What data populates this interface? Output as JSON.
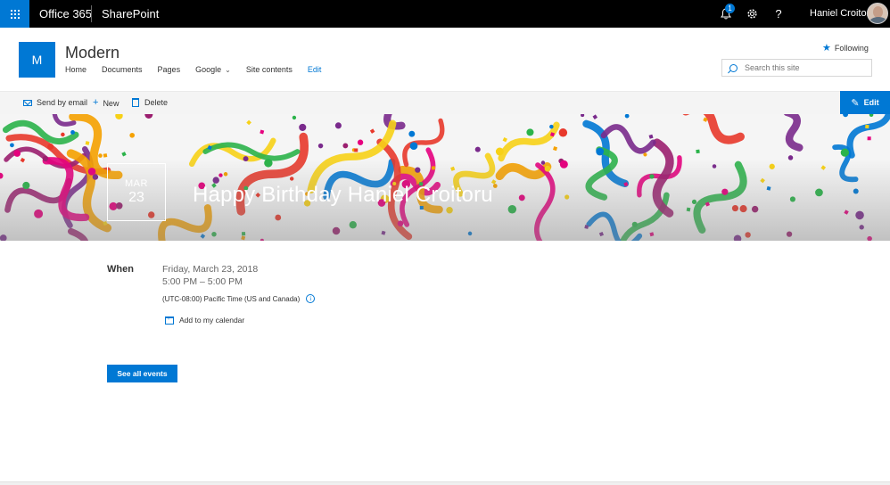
{
  "suite": {
    "brand": "Office 365",
    "app": "SharePoint",
    "notification_count": "1",
    "help_label": "?",
    "user_name": "Haniel Croitoru",
    "accent": "#0078d4"
  },
  "site": {
    "logo_letter": "M",
    "title": "Modern",
    "nav": [
      "Home",
      "Documents",
      "Pages",
      "Google",
      "Site contents",
      "Edit"
    ],
    "following_label": "Following",
    "search_placeholder": "Search this site"
  },
  "commands": {
    "send_email": "Send by email",
    "new": "New",
    "delete": "Delete",
    "edit": "Edit"
  },
  "event": {
    "month": "MAR",
    "day": "23",
    "title": "Happy Birthday Haniel Croitoru",
    "when_label": "When",
    "date": "Friday, March 23, 2018",
    "time": "5:00 PM – 5:00 PM",
    "timezone": "(UTC-08:00) Pacific Time (US and Canada)",
    "add_to_calendar": "Add to my calendar",
    "see_all": "See all events"
  }
}
